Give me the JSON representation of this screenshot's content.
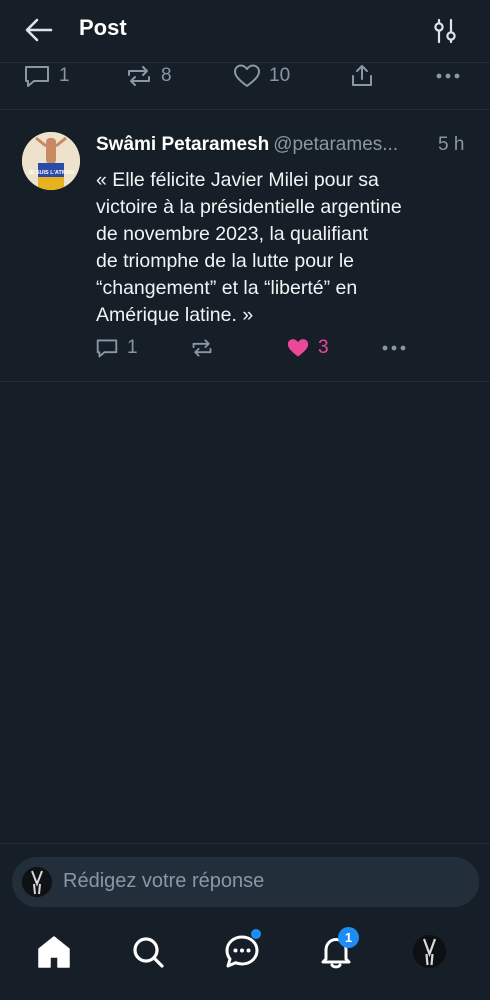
{
  "header": {
    "title": "Post",
    "back_icon": "arrow-left-icon",
    "filter_icon": "sliders-icon"
  },
  "previous_post": {
    "reply_count": "1",
    "repost_count": "8",
    "like_count": "10"
  },
  "post": {
    "author_name": "Swâmi Petaramesh",
    "handle": "@petarames...",
    "time": "5 h",
    "avatar_text": "JE SUIS L'ATMAN",
    "text_lines": [
      "« Elle félicite Javier Milei pour sa",
      "victoire à la présidentielle argentine",
      "de novembre 2023, la qualifiant",
      "de triomphe de la lutte pour le",
      "“changement” et la “liberté” en",
      "Amérique latine. »"
    ],
    "reply_count": "1",
    "like_count": "3",
    "liked": true
  },
  "composer": {
    "placeholder": "Rédigez votre réponse"
  },
  "tabbar": {
    "notification_badge": "1"
  },
  "colors": {
    "background": "#161e27",
    "muted": "#8a97a6",
    "like": "#ec4899",
    "badge": "#1d8cf5"
  }
}
